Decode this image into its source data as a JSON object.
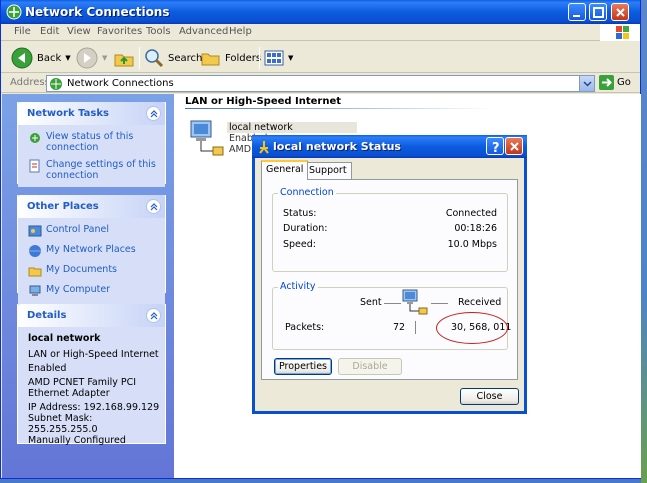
{
  "window": {
    "title": "Network Connections",
    "menu": [
      "File",
      "Edit",
      "View",
      "Favorites",
      "Tools",
      "Advanced",
      "Help"
    ],
    "toolbar": {
      "back": "Back",
      "search": "Search",
      "folders": "Folders"
    },
    "address": {
      "label": "Address",
      "value": "Network Connections",
      "go": "Go"
    }
  },
  "sidebar": {
    "network_tasks": {
      "title": "Network Tasks",
      "items": [
        "View status of this connection",
        "Change settings of this connection"
      ]
    },
    "other_places": {
      "title": "Other Places",
      "items": [
        "Control Panel",
        "My Network Places",
        "My Documents",
        "My Computer"
      ]
    },
    "details": {
      "title": "Details",
      "name": "local network",
      "lines": [
        "LAN or High-Speed Internet",
        "Enabled",
        "AMD PCNET Family PCI Ethernet Adapter",
        "IP Address: 192.168.99.129",
        "Subnet Mask: 255.255.255.0",
        "Manually Configured"
      ]
    }
  },
  "content": {
    "group_title": "LAN or High-Speed Internet",
    "connection": {
      "name": "local network",
      "status": "Enabled",
      "device": "AMD PCNET Family PCI"
    }
  },
  "dialog": {
    "title": "local network Status",
    "tabs": [
      "General",
      "Support"
    ],
    "connection": {
      "legend": "Connection",
      "status_label": "Status:",
      "status_value": "Connected",
      "duration_label": "Duration:",
      "duration_value": "00:18:26",
      "speed_label": "Speed:",
      "speed_value": "10.0 Mbps"
    },
    "activity": {
      "legend": "Activity",
      "sent_label": "Sent",
      "received_label": "Received",
      "packets_label": "Packets:",
      "sent_value": "72",
      "received_value": "30, 568, 011"
    },
    "buttons": {
      "properties": "Properties",
      "disable": "Disable",
      "close": "Close"
    }
  },
  "colors": {
    "xp_blue": "#0a4fcf",
    "link": "#215dc6",
    "annotation": "#c81e1e"
  }
}
